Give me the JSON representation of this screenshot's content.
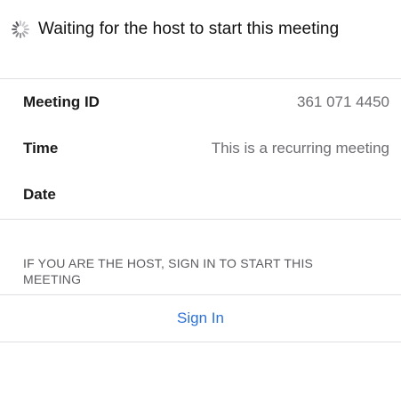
{
  "header": {
    "spinner_icon": "loading-spinner-icon",
    "title": "Waiting for the host to start this meeting"
  },
  "details": {
    "rows": [
      {
        "label": "Meeting ID",
        "value": "361 071 4450"
      },
      {
        "label": "Time",
        "value": "This is a recurring meeting"
      },
      {
        "label": "Date",
        "value": ""
      }
    ]
  },
  "host": {
    "notice": "IF YOU ARE THE HOST, SIGN IN TO START THIS MEETING"
  },
  "actions": {
    "sign_in_label": "Sign In",
    "accent_color": "#2d72d9"
  }
}
